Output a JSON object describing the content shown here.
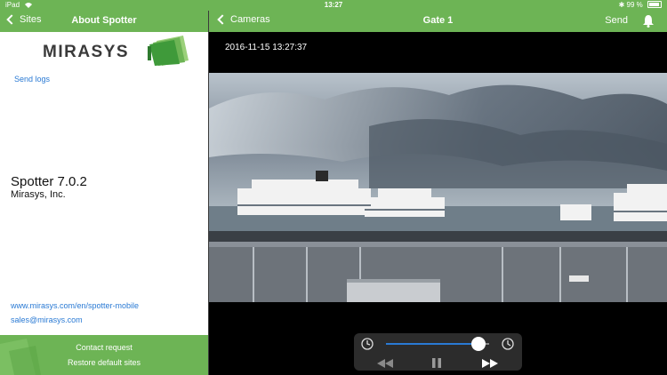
{
  "status_bar": {
    "carrier": "iPad",
    "time": "13:27",
    "battery": "99 %"
  },
  "left_panel": {
    "nav": {
      "back_label": "Sites",
      "title": "About Spotter"
    },
    "logo_text": "MIRASYS",
    "send_logs": "Send logs",
    "app_version": "Spotter 7.0.2",
    "company": "Mirasys, Inc.",
    "website_link": "www.mirasys.com/en/spotter-mobile",
    "email_link": "sales@mirasys.com",
    "footer": {
      "contact_request": "Contact request",
      "restore_defaults": "Restore default sites"
    }
  },
  "right_panel": {
    "nav": {
      "back_label": "Cameras",
      "title": "Gate 1",
      "send_label": "Send"
    },
    "timestamp": "2016-11-15 13:27:37",
    "playback": {
      "position": 0.9
    }
  },
  "colors": {
    "accent": "#6db455",
    "link": "#2a7ad4",
    "slider": "#2a7ad4"
  }
}
